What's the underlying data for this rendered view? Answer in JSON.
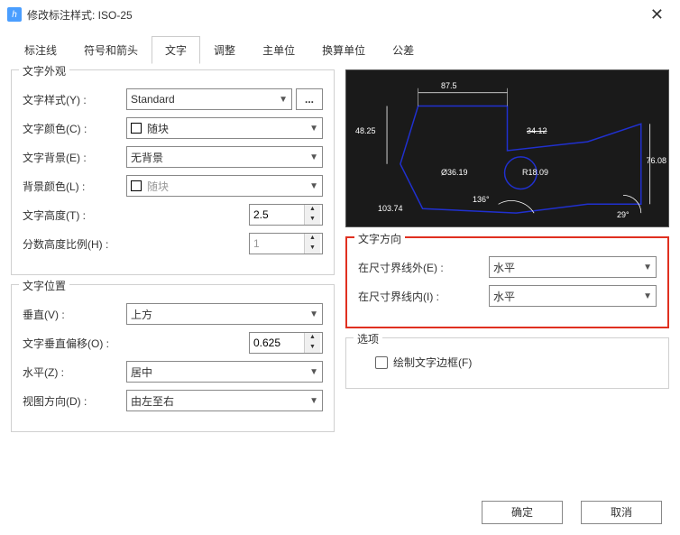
{
  "title": "修改标注样式: ISO-25",
  "tabs": [
    "标注线",
    "符号和箭头",
    "文字",
    "调整",
    "主单位",
    "换算单位",
    "公差"
  ],
  "active_tab": "文字",
  "appearance": {
    "title": "文字外观",
    "style_label": "文字样式(Y) :",
    "style_value": "Standard",
    "ellipsis": "...",
    "color_label": "文字颜色(C) :",
    "color_value": "随块",
    "bg_label": "文字背景(E) :",
    "bg_value": "无背景",
    "bgcolor_label": "背景颜色(L) :",
    "bgcolor_value": "随块",
    "height_label": "文字高度(T) :",
    "height_value": "2.5",
    "frac_label": "分数高度比例(H) :",
    "frac_value": "1"
  },
  "position": {
    "title": "文字位置",
    "vert_label": "垂直(V) :",
    "vert_value": "上方",
    "offset_label": "文字垂直偏移(O) :",
    "offset_value": "0.625",
    "horiz_label": "水平(Z) :",
    "horiz_value": "居中",
    "viewdir_label": "视图方向(D) :",
    "viewdir_value": "由左至右"
  },
  "direction": {
    "title": "文字方向",
    "outside_label": "在尺寸界线外(E) :",
    "outside_value": "水平",
    "inside_label": "在尺寸界线内(I) :",
    "inside_value": "水平"
  },
  "options": {
    "title": "选项",
    "frame_label": "绘制文字边框(F)"
  },
  "preview_dims": {
    "d1": "87.5",
    "d2": "48.25",
    "d3": "34.12",
    "d4": "76.08",
    "d5": "Ø36.19",
    "d6": "R18.09",
    "d7": "103.74",
    "d8": "136°",
    "d9": "29°"
  },
  "buttons": {
    "ok": "确定",
    "cancel": "取消"
  }
}
